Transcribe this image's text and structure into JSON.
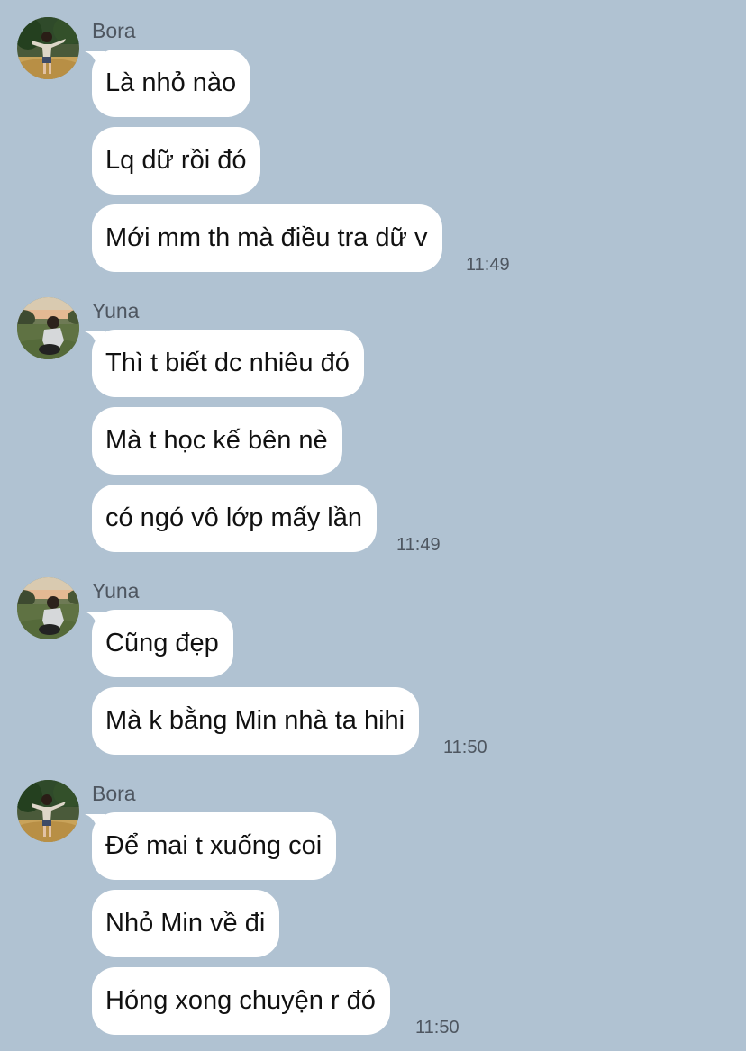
{
  "groups": [
    {
      "sender": "Bora",
      "avatar_icon": "girl-in-field-avatar-icon",
      "messages": [
        "Là nhỏ nào",
        "Lq dữ rồi đó",
        "Mới mm th mà điều tra dữ v"
      ],
      "time": "11:49"
    },
    {
      "sender": "Yuna",
      "avatar_icon": "girl-sitting-on-grass-avatar-icon",
      "messages": [
        "Thì t biết dc nhiêu đó",
        "Mà t học kế bên nè",
        "có ngó vô lớp mấy lần"
      ],
      "time": "11:49"
    },
    {
      "sender": "Yuna",
      "avatar_icon": "girl-sitting-on-grass-avatar-icon",
      "messages": [
        "Cũng đẹp",
        "Mà k bằng Min nhà ta hihi"
      ],
      "time": "11:50"
    },
    {
      "sender": "Bora",
      "avatar_icon": "girl-in-field-avatar-icon",
      "messages": [
        "Để mai t xuống coi",
        "Nhỏ Min về đi",
        "Hóng xong chuyện r đó"
      ],
      "time": "11:50"
    }
  ],
  "colors": {
    "background": "#b0c2d2",
    "bubble": "#ffffff",
    "message_text": "#111111",
    "meta_text": "#4e5660"
  }
}
